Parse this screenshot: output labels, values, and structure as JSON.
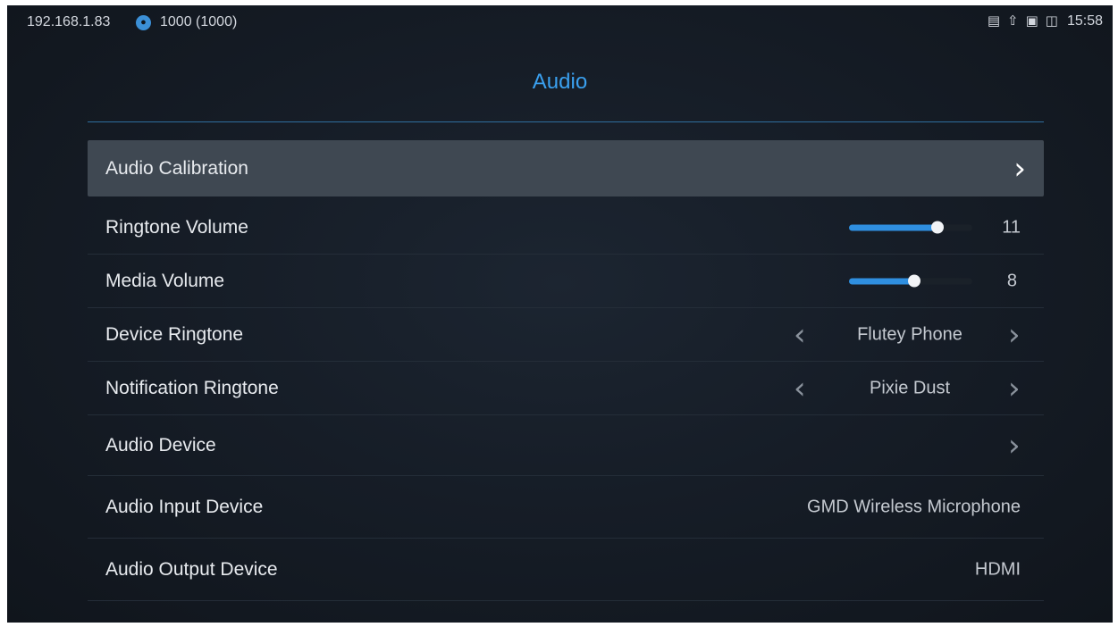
{
  "status_bar": {
    "ip": "192.168.1.83",
    "account_icon": "user-icon",
    "account": "1000 (1000)",
    "icons": [
      "sd-card-icon",
      "upload-icon",
      "usb-storage-icon",
      "network-icon"
    ],
    "time": "15:58"
  },
  "page": {
    "title": "Audio"
  },
  "colors": {
    "accent": "#3aa0ef",
    "slider_fill": "#2f8fe0",
    "selected_row": "#3f4852"
  },
  "settings": {
    "audio_calibration": {
      "label": "Audio Calibration"
    },
    "ringtone_volume": {
      "label": "Ringtone Volume",
      "value": "11",
      "level": 0.72
    },
    "media_volume": {
      "label": "Media Volume",
      "value": "8",
      "level": 0.53
    },
    "device_ringtone": {
      "label": "Device Ringtone",
      "value": "Flutey Phone"
    },
    "notification_ringtone": {
      "label": "Notification Ringtone",
      "value": "Pixie Dust"
    },
    "audio_device": {
      "label": "Audio Device"
    },
    "audio_input_device": {
      "label": "Audio Input Device",
      "value": "GMD Wireless Microphone"
    },
    "audio_output_device": {
      "label": "Audio Output Device",
      "value": "HDMI"
    }
  }
}
